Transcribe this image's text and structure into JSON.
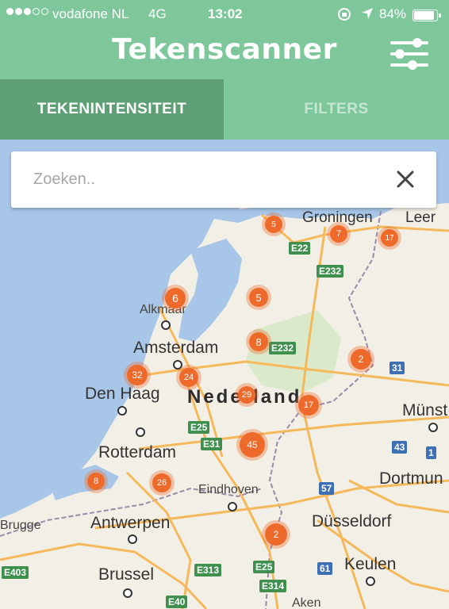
{
  "status_bar": {
    "carrier": "vodafone NL",
    "network": "4G",
    "time": "13:02",
    "battery": "84%",
    "battery_level": 0.84,
    "signal_icon": "signal-dots-icon",
    "rotation_lock_icon": "rotation-lock-icon",
    "location_icon": "location-arrow-icon"
  },
  "app": {
    "title": "Tekenscanner",
    "settings_icon": "sliders-icon"
  },
  "tabs": [
    {
      "label": "TEKENINTENSITEIT",
      "active": true
    },
    {
      "label": "FILTERS",
      "active": false
    }
  ],
  "search": {
    "placeholder": "Zoeken..",
    "value": "",
    "clear_icon": "close-icon"
  },
  "map": {
    "country_label": "Nederland",
    "cities": {
      "groningen": "Groningen",
      "leer": "Leer",
      "alkmaar": "Alkmaar",
      "amsterdam": "Amsterdam",
      "den_haag": "Den Haag",
      "rotterdam": "Rotterdam",
      "eindhoven": "Eindhoven",
      "antwerpen": "Antwerpen",
      "brugge": "Brugge",
      "brussel": "Brussel",
      "dusseldorf": "Düsseldorf",
      "dortmund": "Dortmun",
      "munster": "Münst",
      "keulen": "Keulen",
      "aken": "Aken"
    },
    "roads": [
      "E22",
      "E232",
      "E232",
      "E25",
      "E31",
      "E25",
      "E313",
      "E403",
      "E40",
      "E314",
      "31",
      "43",
      "1",
      "57",
      "61"
    ],
    "clusters": [
      {
        "label": "5"
      },
      {
        "label": "7"
      },
      {
        "label": "17"
      },
      {
        "label": "6"
      },
      {
        "label": "5"
      },
      {
        "label": "8"
      },
      {
        "label": "2"
      },
      {
        "label": "32"
      },
      {
        "label": "24"
      },
      {
        "label": "29"
      },
      {
        "label": "17"
      },
      {
        "label": "45"
      },
      {
        "label": "8"
      },
      {
        "label": "26"
      },
      {
        "label": "2"
      }
    ],
    "colors": {
      "header": "#7ec79a",
      "active_tab": "#5f9f75",
      "cluster": "#ee6a2a",
      "water": "#a8c6e8",
      "land": "#f2efe6"
    }
  }
}
